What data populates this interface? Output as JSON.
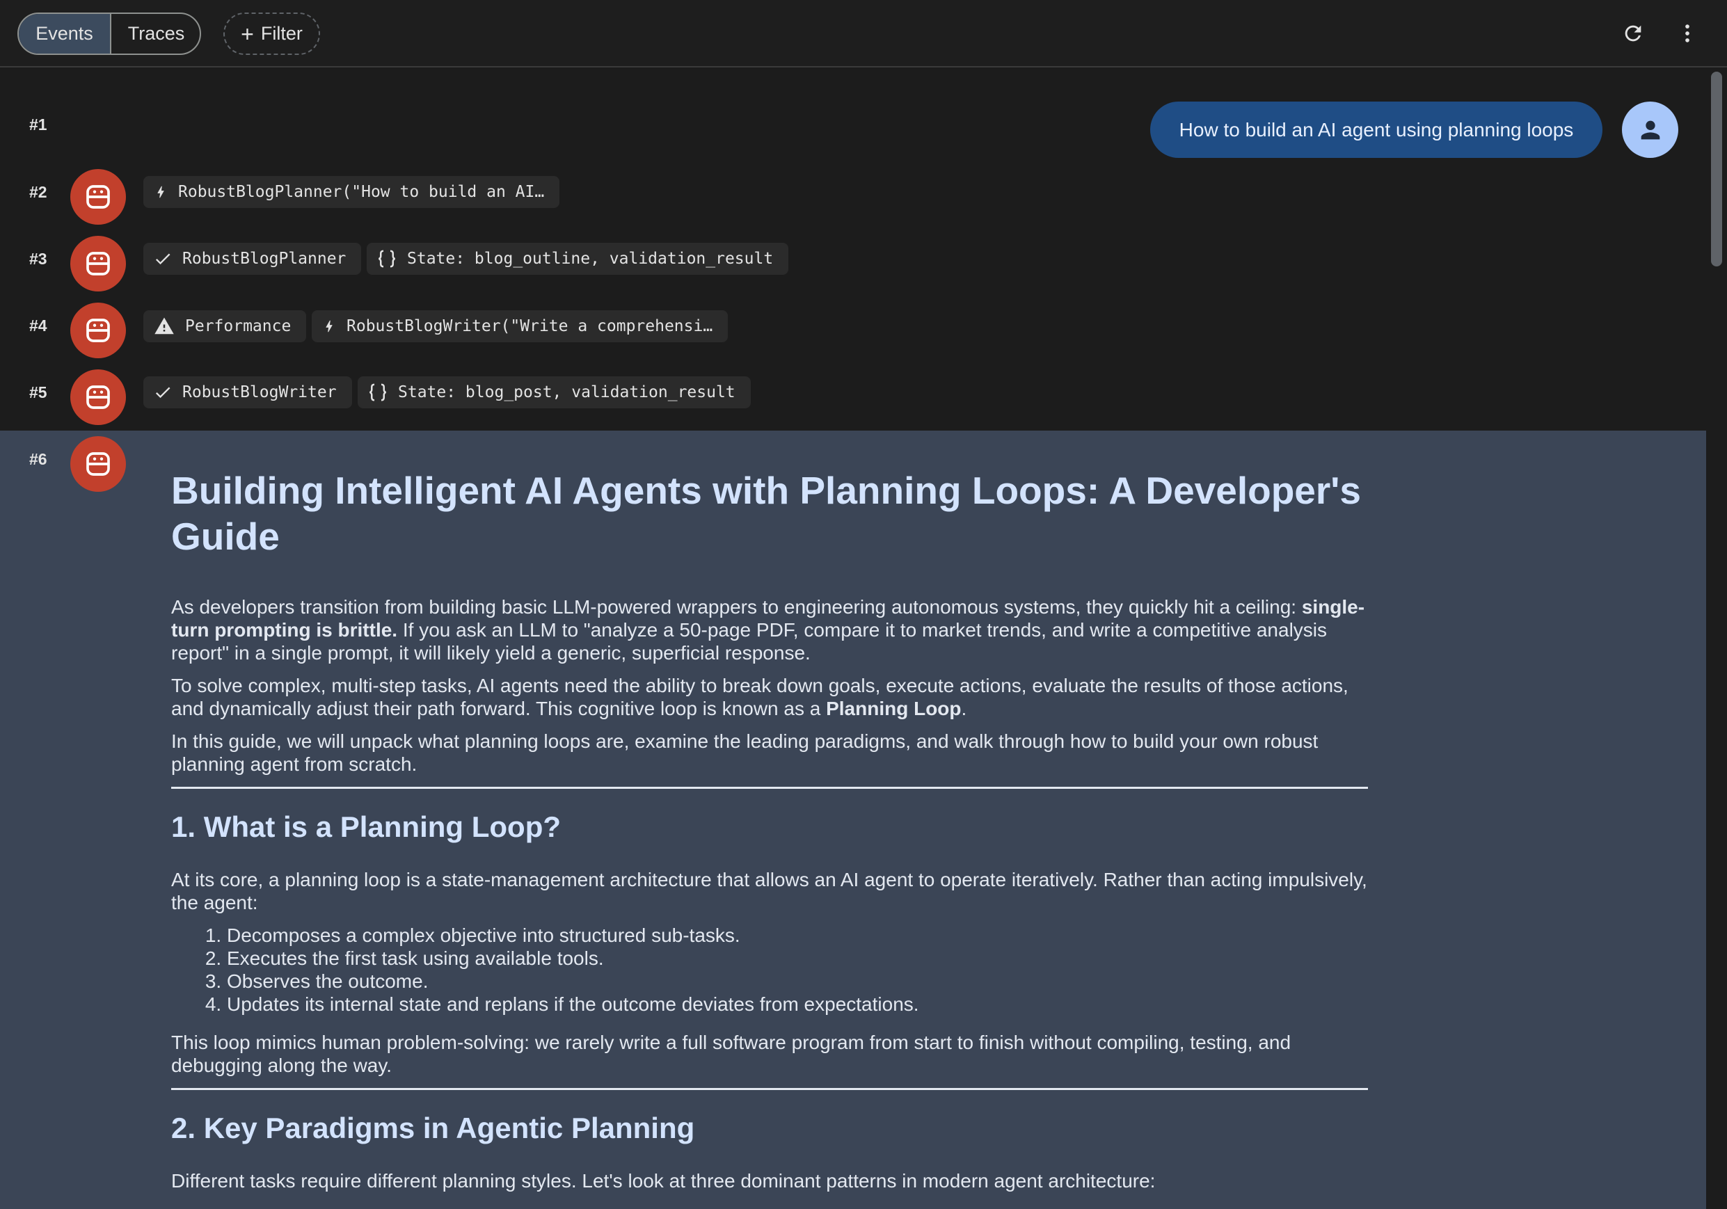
{
  "toolbar": {
    "tabs": [
      {
        "label": "Events",
        "active": true
      },
      {
        "label": "Traces",
        "active": false
      }
    ],
    "filter_label": "Filter",
    "icons": {
      "refresh": "refresh-icon",
      "more": "more-vert-icon",
      "filter": "plus-icon"
    }
  },
  "events": [
    {
      "num": "#1",
      "type": "user",
      "text": "How to build an AI agent using planning loops"
    },
    {
      "num": "#2",
      "type": "agent",
      "chips": [
        {
          "icon": "bolt-icon",
          "text": "RobustBlogPlanner(\"How to build an AI…"
        }
      ]
    },
    {
      "num": "#3",
      "type": "agent",
      "chips": [
        {
          "icon": "check-icon",
          "text": "RobustBlogPlanner"
        },
        {
          "icon": "braces-icon",
          "text": "State: blog_outline, validation_result"
        }
      ]
    },
    {
      "num": "#4",
      "type": "agent",
      "chips": [
        {
          "icon": "warning-icon",
          "text": "Performance"
        },
        {
          "icon": "bolt-icon",
          "text": "RobustBlogWriter(\"Write a comprehensi…"
        }
      ]
    },
    {
      "num": "#5",
      "type": "agent",
      "chips": [
        {
          "icon": "check-icon",
          "text": "RobustBlogWriter"
        },
        {
          "icon": "braces-icon",
          "text": "State: blog_post, validation_result"
        }
      ]
    },
    {
      "num": "#6",
      "type": "agent"
    }
  ],
  "article": {
    "title": "Building Intelligent AI Agents with Planning Loops: A Developer's Guide",
    "intro_p1_a": "As developers transition from building basic LLM-powered wrappers to engineering autonomous systems, they quickly hit a ceiling: ",
    "intro_p1_b": "single-turn prompting is brittle.",
    "intro_p1_c": " If you ask an LLM to \"analyze a 50-page PDF, compare it to market trends, and write a competitive analysis report\" in a single prompt, it will likely yield a generic, superficial response.",
    "intro_p2_a": "To solve complex, multi-step tasks, AI agents need the ability to break down goals, execute actions, evaluate the results of those actions, and dynamically adjust their path forward. This cognitive loop is known as a ",
    "intro_p2_b": "Planning Loop",
    "intro_p2_c": ".",
    "intro_p3": "In this guide, we will unpack what planning loops are, examine the leading paradigms, and walk through how to build your own robust planning agent from scratch.",
    "s1_heading": "1. What is a Planning Loop?",
    "s1_p1": "At its core, a planning loop is a state-management architecture that allows an AI agent to operate iteratively. Rather than acting impulsively, the agent:",
    "s1_list": [
      "Decomposes a complex objective into structured sub-tasks.",
      "Executes the first task using available tools.",
      "Observes the outcome.",
      "Updates its internal state and replans if the outcome deviates from expectations."
    ],
    "s1_p2": "This loop mimics human problem-solving: we rarely write a full software program from start to finish without compiling, testing, and debugging along the way.",
    "s2_heading": "2. Key Paradigms in Agentic Planning",
    "s2_p1": "Different tasks require different planning styles. Let's look at three dominant patterns in modern agent architecture:"
  },
  "colors": {
    "agent_avatar": "#c2402c",
    "user_bubble": "#1f4d85",
    "user_avatar": "#a8c7fa",
    "selected_bg": "#3b4556"
  }
}
